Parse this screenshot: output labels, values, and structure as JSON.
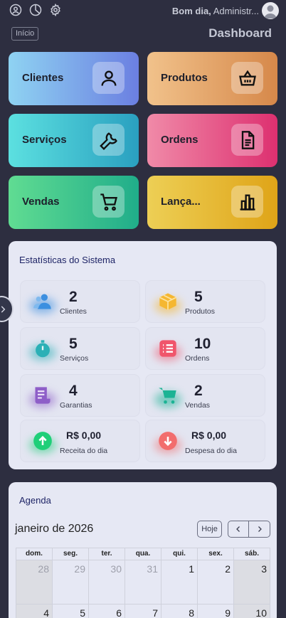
{
  "header": {
    "greeting_prefix": "Bom dia,",
    "greeting_name": "Administr..."
  },
  "breadcrumb": {
    "label": "Início"
  },
  "page": {
    "title": "Dashboard"
  },
  "menu": [
    {
      "label": "Clientes",
      "icon": "user-icon"
    },
    {
      "label": "Produtos",
      "icon": "basket-icon"
    },
    {
      "label": "Serviços",
      "icon": "wrench-icon"
    },
    {
      "label": "Ordens",
      "icon": "document-icon"
    },
    {
      "label": "Vendas",
      "icon": "cart-icon"
    },
    {
      "label": "Lança...",
      "icon": "bar-chart-icon"
    }
  ],
  "stats": {
    "title": "Estatísticas do Sistema",
    "items": [
      {
        "value": "2",
        "label": "Clientes",
        "icon": "users-icon",
        "color": "#3b8fe0"
      },
      {
        "value": "5",
        "label": "Produtos",
        "icon": "box-icon",
        "color": "#f5b731"
      },
      {
        "value": "5",
        "label": "Serviços",
        "icon": "stopwatch-icon",
        "color": "#2bb0b6"
      },
      {
        "value": "10",
        "label": "Ordens",
        "icon": "list-icon",
        "color": "#f0556b"
      },
      {
        "value": "4",
        "label": "Garantias",
        "icon": "receipt-icon",
        "color": "#8e5ec8"
      },
      {
        "value": "2",
        "label": "Vendas",
        "icon": "cart-icon",
        "color": "#1bb394"
      },
      {
        "value": "R$ 0,00",
        "label": "Receita do dia",
        "icon": "arrow-up-circle-icon",
        "color": "#1fcf78"
      },
      {
        "value": "R$ 0,00",
        "label": "Despesa do dia",
        "icon": "arrow-down-circle-icon",
        "color": "#f26d6d"
      }
    ]
  },
  "agenda": {
    "title": "Agenda",
    "month": "janeiro de 2026",
    "today_label": "Hoje",
    "weekdays": [
      "dom.",
      "seg.",
      "ter.",
      "qua.",
      "qui.",
      "sex.",
      "sáb."
    ],
    "week1": [
      "28",
      "29",
      "30",
      "31",
      "1",
      "2",
      "3"
    ],
    "week2": [
      "4",
      "5",
      "6",
      "7",
      "8",
      "9",
      "10"
    ]
  }
}
